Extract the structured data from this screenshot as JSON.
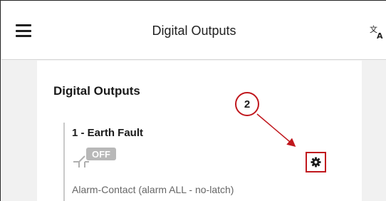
{
  "header": {
    "title": "Digital Outputs",
    "menu_icon": "hamburger-menu-icon",
    "translate_icon": "translate-icon"
  },
  "panel": {
    "title": "Digital Outputs"
  },
  "outputs": [
    {
      "name": "1 - Earth Fault",
      "state": "OFF",
      "description": "Alarm-Contact (alarm ALL - no-latch)",
      "settings_icon": "gear-icon"
    }
  ],
  "annotation": {
    "callout_number": "2",
    "color": "#c0171d"
  },
  "colors": {
    "background": "#f1f1f1",
    "panel": "#ffffff",
    "state_badge": "#b8b8b8",
    "accent": "#c0171d"
  }
}
